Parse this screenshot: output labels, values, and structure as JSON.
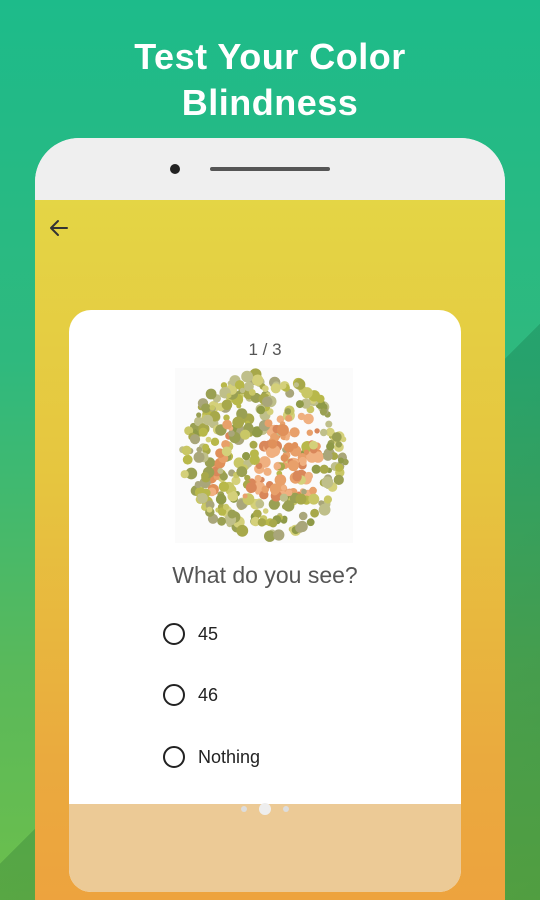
{
  "headline": {
    "line1": "Test Your Color",
    "line2": "Blindness"
  },
  "quiz": {
    "progress": "1 / 3",
    "question": "What do you see?",
    "options": [
      {
        "label": "45"
      },
      {
        "label": "46"
      },
      {
        "label": "Nothing"
      }
    ]
  },
  "pager": {
    "count": 3,
    "active": 1
  },
  "colors": {
    "background_top": "#1dbb8a",
    "screen_top": "#e4d545",
    "screen_bottom": "#eda33e",
    "card": "#ffffff",
    "card_footer": "#ecca96"
  }
}
